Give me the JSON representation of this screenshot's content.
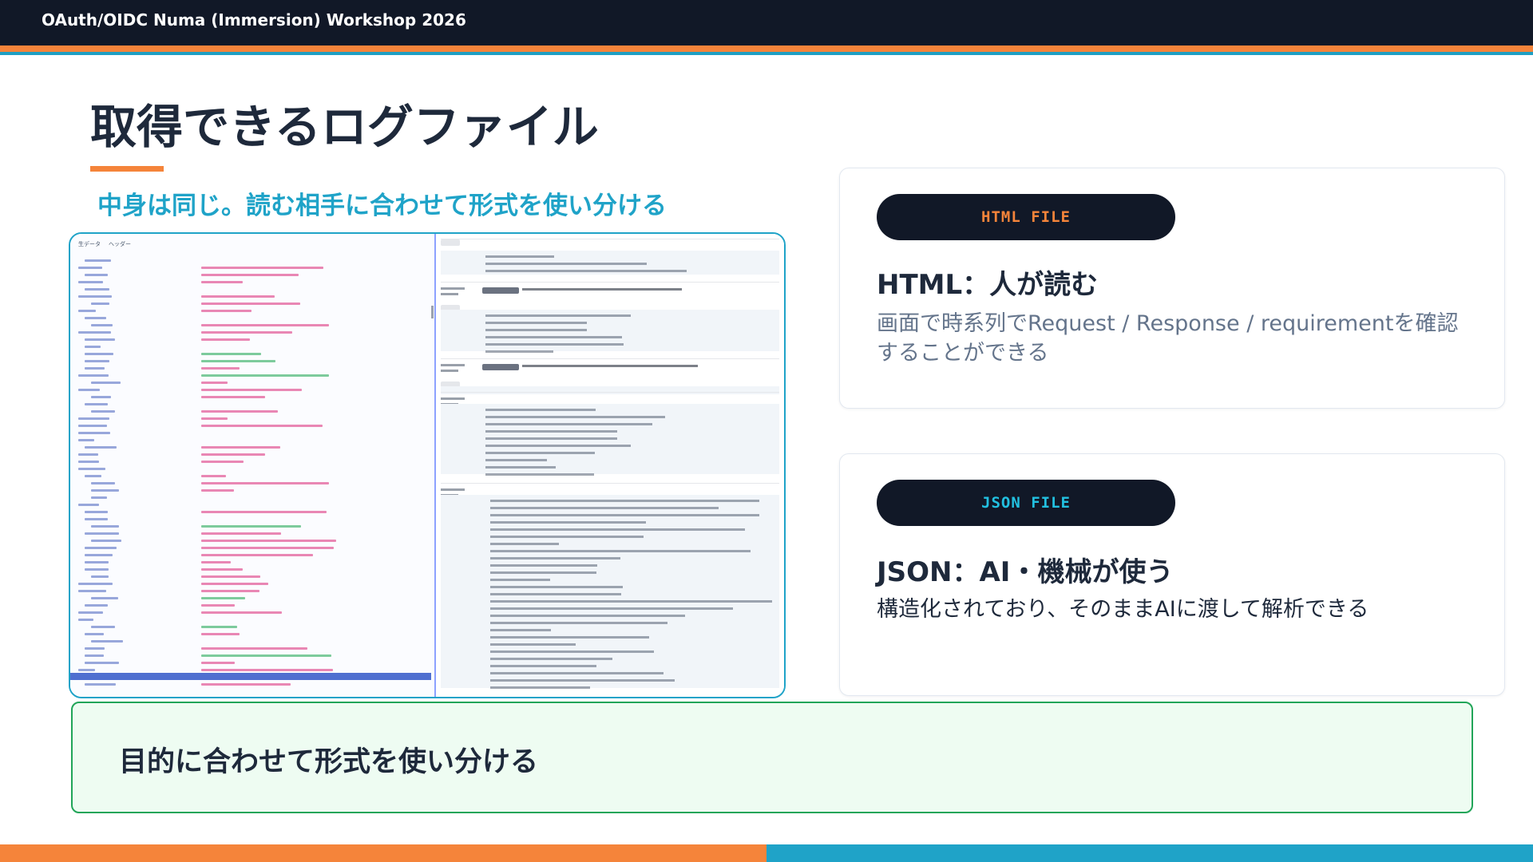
{
  "header": {
    "title": "OAuth/OIDC Numa (Immersion) Workshop 2026"
  },
  "slide": {
    "title": "取得できるログファイル",
    "subtitle": "中身は同じ。読む相手に合わせて形式を使い分ける"
  },
  "screenshot": {
    "tabs": [
      "生データ",
      "ヘッダー"
    ]
  },
  "cards": [
    {
      "badge": "HTML FILE",
      "heading": "HTML：人が読む",
      "body": "画面で時系列でRequest / Response / requirementを確認することができる"
    },
    {
      "badge": "JSON FILE",
      "heading": "JSON：AI・機械が使う",
      "body": "構造化されており、そのままAIに渡して解析できる"
    }
  ],
  "banner": {
    "text": "目的に合わせて形式を使い分ける"
  },
  "colors": {
    "dark": "#111827",
    "orange": "#f5843a",
    "teal": "#1fa3c8",
    "green": "#22a559",
    "green_bg": "#eefcf2"
  }
}
